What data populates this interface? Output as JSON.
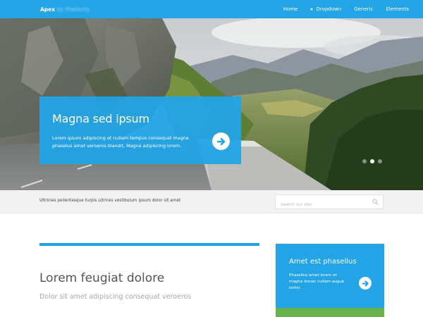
{
  "header": {
    "brand": "Apex",
    "brand_by": "by Pixelarity",
    "nav": [
      {
        "label": "Home"
      },
      {
        "label": "Dropdown"
      },
      {
        "label": "Generic"
      },
      {
        "label": "Elements"
      }
    ]
  },
  "hero": {
    "title": "Magna sed ipsum",
    "text": "Lorem ipsum adipiscing et nullam tempus consequat magna phaselus amet veroeros blandit, Magna adipiscing lorem.",
    "slides": 3,
    "active_slide": 2
  },
  "strip": {
    "tagline": "Ultricies pellentesque turpis ultrices vestibulum ipsum dolor sit amet",
    "search_placeholder": "Search our site"
  },
  "main": {
    "title": "Lorem feugiat dolore",
    "subtitle": "Dolor sit amet adipiscing consequat veroeros"
  },
  "sidebar": {
    "title": "Amet est phasellus",
    "text": "Phasellus amet lorem et magna donec nullam augue tortor."
  },
  "colors": {
    "accent": "#22a4e6",
    "green": "#6ab04c",
    "strip_bg": "#f3f3f3"
  }
}
